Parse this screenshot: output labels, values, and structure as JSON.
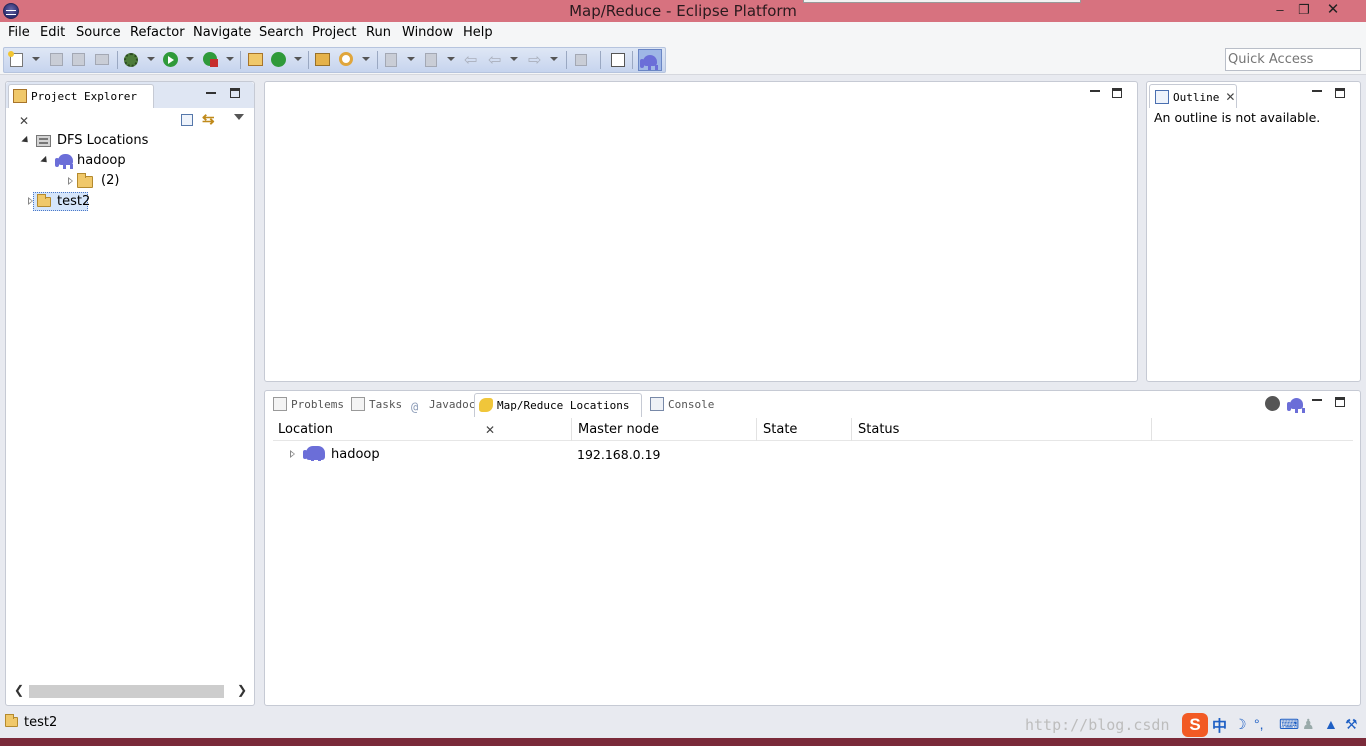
{
  "window": {
    "title": "Map/Reduce - Eclipse Platform"
  },
  "menu": [
    "File",
    "Edit",
    "Source",
    "Refactor",
    "Navigate",
    "Search",
    "Project",
    "Run",
    "Window",
    "Help"
  ],
  "toolbar": {
    "quick_access_placeholder": "Quick Access"
  },
  "project_explorer": {
    "tab_label": "Project Explorer",
    "tree": {
      "dfs_label": "DFS Locations",
      "hadoop_label": "hadoop",
      "folder_label": "(2)",
      "project_label": "test2"
    }
  },
  "outline": {
    "tab_label": "Outline",
    "message": "An outline is not available."
  },
  "bottom_panel": {
    "tabs": [
      "Problems",
      "Tasks",
      "Javadoc",
      "Map/Reduce Locations",
      "Console"
    ],
    "active_tab": "Map/Reduce Locations",
    "columns": [
      "Location",
      "Master node",
      "State",
      "Status"
    ],
    "rows": [
      {
        "location": "hadoop",
        "master_node": "192.168.0.19",
        "state": "",
        "status": ""
      }
    ]
  },
  "statusbar": {
    "selection": "test2",
    "watermark": "http://blog.csdn",
    "ime_label": "中"
  },
  "colors": {
    "titlebar": "#d7727f",
    "toolbar_gradient": "#c6d4ee",
    "hadoop_icon": "#6b6ed8",
    "active_perspective": "#9fb7e6"
  }
}
